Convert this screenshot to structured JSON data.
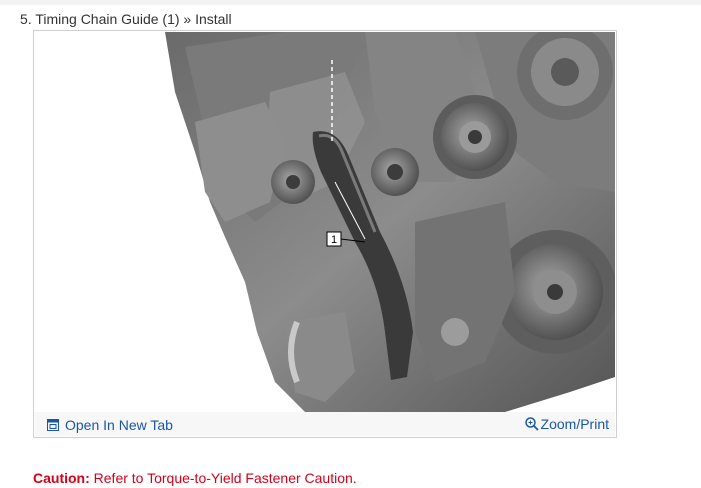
{
  "step": {
    "title": "5. Timing Chain Guide (1) » Install"
  },
  "figure": {
    "callout_number": "1",
    "open_tab_label": "Open In New Tab",
    "open_tab_icon": "open-in-new-tab-icon",
    "zoom_label": "Zoom/Print",
    "zoom_icon": "magnifier-icon"
  },
  "caution": {
    "label": "Caution:",
    "text": "Refer to Torque-to-Yield Fastener Caution."
  },
  "colors": {
    "link": "#1a56a6",
    "caution": "#d0021b",
    "text": "#333333"
  }
}
